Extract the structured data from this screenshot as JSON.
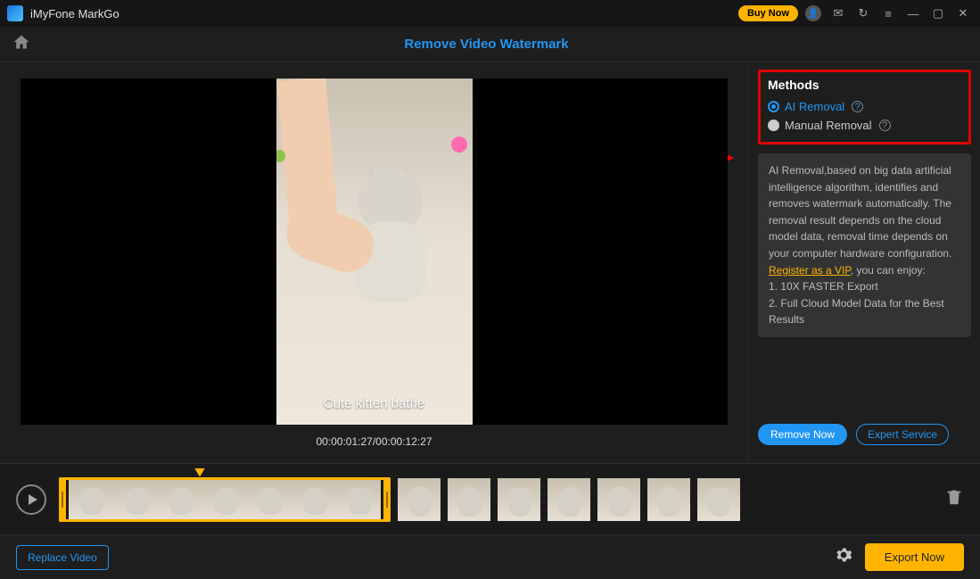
{
  "app": {
    "title": "iMyFone MarkGo",
    "buy_label": "Buy Now"
  },
  "header": {
    "page_title": "Remove Video Watermark"
  },
  "video": {
    "caption": "Cute kitten bathe",
    "timecode": "00:00:01:27/00:00:12:27"
  },
  "methods": {
    "title": "Methods",
    "ai_label": "AI Removal",
    "manual_label": "Manual Removal"
  },
  "description": {
    "text": "AI Removal,based on big data artificial intelligence algorithm, identifies and removes watermark automatically. The removal result depends on the cloud model data, removal time depends on your computer hardware configuration. ",
    "link": "Register as a VIP",
    "after_link": ", you can enjoy:",
    "line1": "1. 10X FASTER Export",
    "line2": "2. Full Cloud Model Data for the Best Results"
  },
  "actions": {
    "remove_now": "Remove Now",
    "expert": "Expert Service"
  },
  "footer": {
    "replace": "Replace Video",
    "export": "Export Now"
  }
}
